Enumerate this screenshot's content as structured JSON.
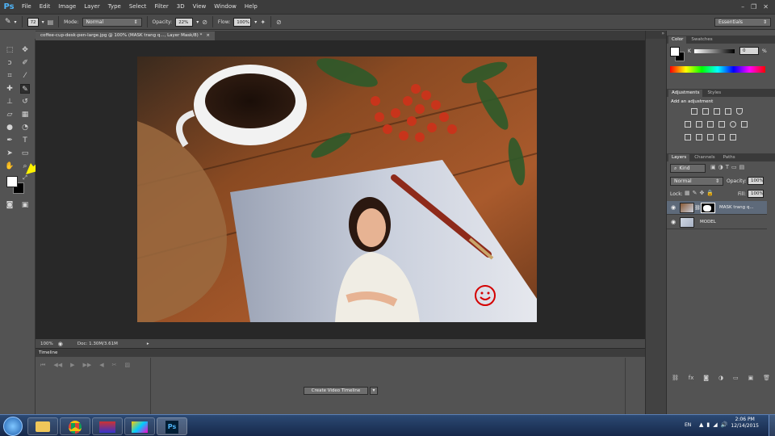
{
  "menubar": {
    "logo": "Ps",
    "items": [
      "File",
      "Edit",
      "Image",
      "Layer",
      "Type",
      "Select",
      "Filter",
      "3D",
      "View",
      "Window",
      "Help"
    ]
  },
  "options": {
    "brush_size": "72",
    "mode_label": "Mode:",
    "mode_value": "Normal",
    "opacity_label": "Opacity:",
    "opacity_value": "22%",
    "flow_label": "Flow:",
    "flow_value": "100%",
    "workspace": "Essentials"
  },
  "document": {
    "tab_title": "coffee-cup-desk-pen-large.jpg @ 100% (MASK trang q..., Layer Mask/8) *",
    "close": "×",
    "zoom": "100%",
    "doc_info": "Doc: 1.30M/3.61M"
  },
  "timeline": {
    "title": "Timeline",
    "create_button": "Create Video Timeline"
  },
  "color_panel": {
    "tabs": [
      "Color",
      "Swatches"
    ],
    "k_label": "K",
    "k_value": "0",
    "k_unit": "%"
  },
  "adjustments_panel": {
    "tabs": [
      "Adjustments",
      "Styles"
    ],
    "heading": "Add an adjustment"
  },
  "layers_panel": {
    "tabs": [
      "Layers",
      "Channels",
      "Paths"
    ],
    "kind": "Kind",
    "blend_mode": "Normal",
    "opacity_label": "Opacity:",
    "opacity_value": "100%",
    "lock_label": "Lock:",
    "fill_label": "Fill:",
    "fill_value": "100%",
    "layers": [
      {
        "name": "MASK trang q..."
      },
      {
        "name": "MODEL"
      }
    ]
  },
  "taskbar": {
    "lang": "EN",
    "time": "2:06 PM",
    "date": "12/14/2015"
  },
  "colors": {
    "accent_ps": "#4fb3f6",
    "annotation_arrow": "#fff200",
    "smiley": "#d40000"
  }
}
